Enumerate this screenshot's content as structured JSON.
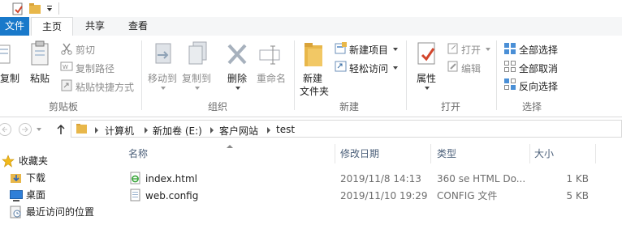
{
  "tabs": {
    "file": "文件",
    "home": "主页",
    "share": "共享",
    "view": "查看"
  },
  "ribbon": {
    "clipboard": {
      "copy": "复制",
      "paste": "粘贴",
      "cut": "剪切",
      "copy_path": "复制路径",
      "paste_shortcut": "粘贴快捷方式",
      "label": "剪贴板"
    },
    "organize": {
      "move_to": "移动到",
      "copy_to": "复制到",
      "delete": "删除",
      "rename": "重命名",
      "label": "组织"
    },
    "new": {
      "new_folder_line1": "新建",
      "new_folder_line2": "文件夹",
      "new_item": "新建项目",
      "easy_access": "轻松访问",
      "label": "新建"
    },
    "open": {
      "properties": "属性",
      "open": "打开",
      "edit": "编辑",
      "label": "打开"
    },
    "select": {
      "select_all": "全部选择",
      "select_none": "全部取消",
      "invert": "反向选择",
      "label": "选择"
    }
  },
  "address": {
    "segments": [
      "计算机",
      "新加卷 (E:)",
      "客户网站",
      "test"
    ]
  },
  "nav_pane": {
    "favorites": "收藏夹",
    "items": [
      "下载",
      "桌面",
      "最近访问的位置"
    ]
  },
  "columns": {
    "name": "名称",
    "modified": "修改日期",
    "type": "类型",
    "size": "大小"
  },
  "files": [
    {
      "name": "index.html",
      "modified": "2019/11/8 14:13",
      "type": "360 se HTML Do...",
      "size": "1 KB",
      "icon": "html-file-icon"
    },
    {
      "name": "web.config",
      "modified": "2019/11/10 19:29",
      "type": "CONFIG 文件",
      "size": "5 KB",
      "icon": "config-file-icon"
    }
  ],
  "colors": {
    "accent": "#1979ca",
    "folder": "#e8b74a"
  }
}
